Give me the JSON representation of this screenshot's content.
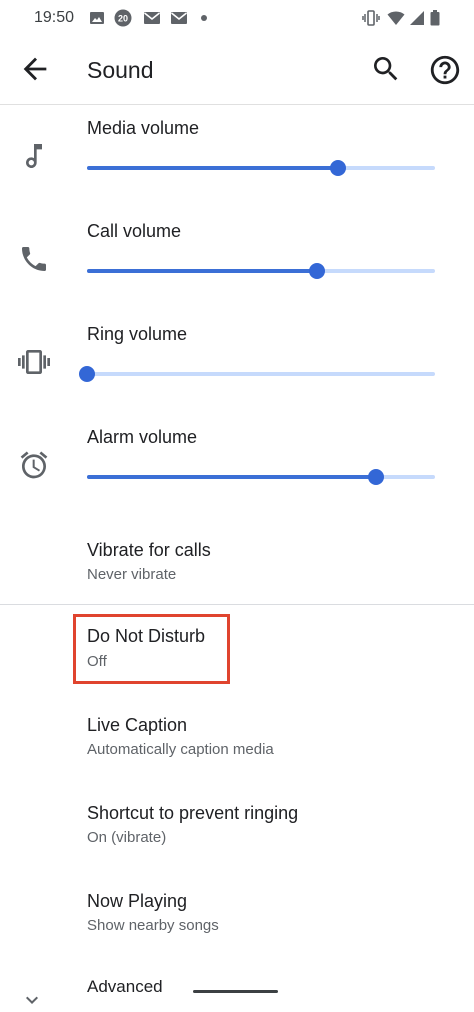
{
  "status_bar": {
    "time": "19:50",
    "left_icons": [
      "image-icon",
      "badge-20-icon",
      "mail-icon",
      "mail-icon",
      "dot-icon"
    ],
    "right_icons": [
      "vibrate-icon",
      "wifi-icon",
      "signal-icon",
      "battery-icon"
    ]
  },
  "app_bar": {
    "title": "Sound",
    "back_icon": "arrow-back-icon",
    "actions": [
      "search-icon",
      "help-icon"
    ]
  },
  "volumes": [
    {
      "label": "Media volume",
      "icon": "music-note-icon",
      "level": 0.72
    },
    {
      "label": "Call volume",
      "icon": "phone-icon",
      "level": 0.66
    },
    {
      "label": "Ring volume",
      "icon": "vibrate-icon",
      "level": 0.0
    },
    {
      "label": "Alarm volume",
      "icon": "alarm-icon",
      "level": 0.83
    }
  ],
  "settings": {
    "vibrate": {
      "title": "Vibrate for calls",
      "subtitle": "Never vibrate"
    },
    "dnd": {
      "title": "Do Not Disturb",
      "subtitle": "Off"
    },
    "live_caption": {
      "title": "Live Caption",
      "subtitle": "Automatically caption media"
    },
    "shortcut": {
      "title": "Shortcut to prevent ringing",
      "subtitle": "On (vibrate)"
    },
    "now_playing": {
      "title": "Now Playing",
      "subtitle": "Show nearby songs"
    },
    "advanced": {
      "title": "Advanced",
      "icon": "chevron-down-icon"
    }
  },
  "colors": {
    "accent": "#3367d6",
    "track_inactive": "#c6dafc",
    "highlight": "#e0442e"
  }
}
